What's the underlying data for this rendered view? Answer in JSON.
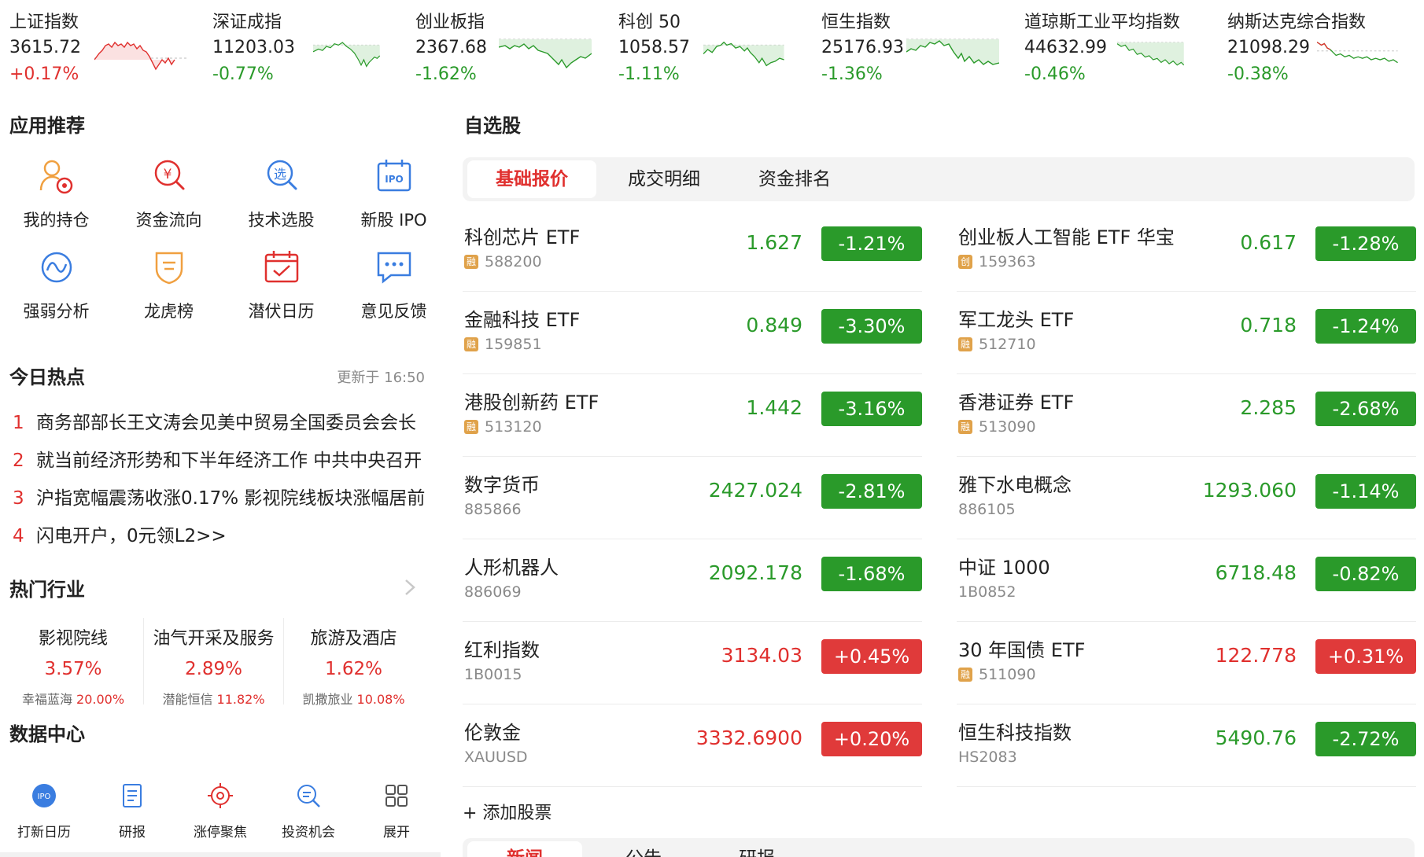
{
  "indices": [
    {
      "name": "上证指数",
      "price": "3615.72",
      "change": "+0.17%",
      "dir": "up"
    },
    {
      "name": "深证成指",
      "price": "11203.03",
      "change": "-0.77%",
      "dir": "down"
    },
    {
      "name": "创业板指",
      "price": "2367.68",
      "change": "-1.62%",
      "dir": "down"
    },
    {
      "name": "科创 50",
      "price": "1058.57",
      "change": "-1.11%",
      "dir": "down"
    },
    {
      "name": "恒生指数",
      "price": "25176.93",
      "change": "-1.36%",
      "dir": "down"
    },
    {
      "name": "道琼斯工业平均指数",
      "price": "44632.99",
      "change": "-0.46%",
      "dir": "down"
    },
    {
      "name": "纳斯达克综合指数",
      "price": "21098.29",
      "change": "-0.38%",
      "dir": "down"
    }
  ],
  "apps": {
    "title": "应用推荐",
    "items": [
      {
        "label": "我的持仓",
        "icon": "position-icon"
      },
      {
        "label": "资金流向",
        "icon": "money-flow-icon"
      },
      {
        "label": "技术选股",
        "icon": "stock-picker-icon"
      },
      {
        "label": "新股 IPO",
        "icon": "ipo-calendar-icon"
      },
      {
        "label": "强弱分析",
        "icon": "strength-analysis-icon"
      },
      {
        "label": "龙虎榜",
        "icon": "dragon-tiger-icon"
      },
      {
        "label": "潜伏日历",
        "icon": "calendar-check-icon"
      },
      {
        "label": "意见反馈",
        "icon": "feedback-icon"
      }
    ]
  },
  "hot_news": {
    "title": "今日热点",
    "updated": "更新于 16:50",
    "items": [
      {
        "num": "1",
        "text": "商务部部长王文涛会见美中贸易全国委员会会长"
      },
      {
        "num": "2",
        "text": "就当前经济形势和下半年经济工作 中共中央召开"
      },
      {
        "num": "3",
        "text": "沪指宽幅震荡收涨0.17% 影视院线板块涨幅居前"
      },
      {
        "num": "4",
        "text": "闪电开户，0元领L2>>"
      }
    ]
  },
  "industries": {
    "title": "热门行业",
    "items": [
      {
        "name": "影视院线",
        "pct": "3.57%",
        "leader": "幸福蓝海",
        "leader_pct": "20.00%"
      },
      {
        "name": "油气开采及服务",
        "pct": "2.89%",
        "leader": "潜能恒信",
        "leader_pct": "11.82%"
      },
      {
        "name": "旅游及酒店",
        "pct": "1.62%",
        "leader": "凯撒旅业",
        "leader_pct": "10.08%"
      }
    ]
  },
  "data_center": {
    "title": "数据中心",
    "items": [
      {
        "label": "打新日历",
        "icon": "ipo-badge-icon"
      },
      {
        "label": "研报",
        "icon": "report-icon"
      },
      {
        "label": "涨停聚焦",
        "icon": "target-icon"
      },
      {
        "label": "投资机会",
        "icon": "search-icon"
      },
      {
        "label": "展开",
        "icon": "grid-icon"
      }
    ]
  },
  "watchlist": {
    "title": "自选股",
    "tabs": [
      "基础报价",
      "成交明细",
      "资金排名"
    ],
    "active_tab": 0,
    "left": [
      {
        "name": "科创芯片 ETF",
        "code": "588200",
        "badge": "融",
        "price": "1.627",
        "change": "-1.21%",
        "dir": "down"
      },
      {
        "name": "金融科技 ETF",
        "code": "159851",
        "badge": "融",
        "price": "0.849",
        "change": "-3.30%",
        "dir": "down"
      },
      {
        "name": "港股创新药 ETF",
        "code": "513120",
        "badge": "融",
        "price": "1.442",
        "change": "-3.16%",
        "dir": "down"
      },
      {
        "name": "数字货币",
        "code": "885866",
        "badge": "",
        "price": "2427.024",
        "change": "-2.81%",
        "dir": "down"
      },
      {
        "name": "人形机器人",
        "code": "886069",
        "badge": "",
        "price": "2092.178",
        "change": "-1.68%",
        "dir": "down"
      },
      {
        "name": "红利指数",
        "code": "1B0015",
        "badge": "",
        "price": "3134.03",
        "change": "+0.45%",
        "dir": "up"
      },
      {
        "name": "伦敦金",
        "code": "XAUUSD",
        "badge": "",
        "price": "3332.6900",
        "change": "+0.20%",
        "dir": "up"
      }
    ],
    "right": [
      {
        "name": "创业板人工智能 ETF 华宝",
        "code": "159363",
        "badge": "创",
        "price": "0.617",
        "change": "-1.28%",
        "dir": "down"
      },
      {
        "name": "军工龙头 ETF",
        "code": "512710",
        "badge": "融",
        "price": "0.718",
        "change": "-1.24%",
        "dir": "down"
      },
      {
        "name": "香港证券 ETF",
        "code": "513090",
        "badge": "融",
        "price": "2.285",
        "change": "-2.68%",
        "dir": "down"
      },
      {
        "name": "雅下水电概念",
        "code": "886105",
        "badge": "",
        "price": "1293.060",
        "change": "-1.14%",
        "dir": "down"
      },
      {
        "name": "中证 1000",
        "code": "1B0852",
        "badge": "",
        "price": "6718.48",
        "change": "-0.82%",
        "dir": "down"
      },
      {
        "name": "30 年国债 ETF",
        "code": "511090",
        "badge": "融",
        "price": "122.778",
        "change": "+0.31%",
        "dir": "up"
      },
      {
        "name": "恒生科技指数",
        "code": "HS2083",
        "badge": "",
        "price": "5490.76",
        "change": "-2.72%",
        "dir": "down"
      }
    ],
    "add_label": "+ 添加股票"
  },
  "news_tabs": [
    "新闻",
    "公告",
    "研报"
  ],
  "colors": {
    "up": "#e0302e",
    "down": "#2a9a2a",
    "pill_up": "#e03a3a",
    "pill_down": "#2a9a2a",
    "badge": "#e0a24a"
  }
}
